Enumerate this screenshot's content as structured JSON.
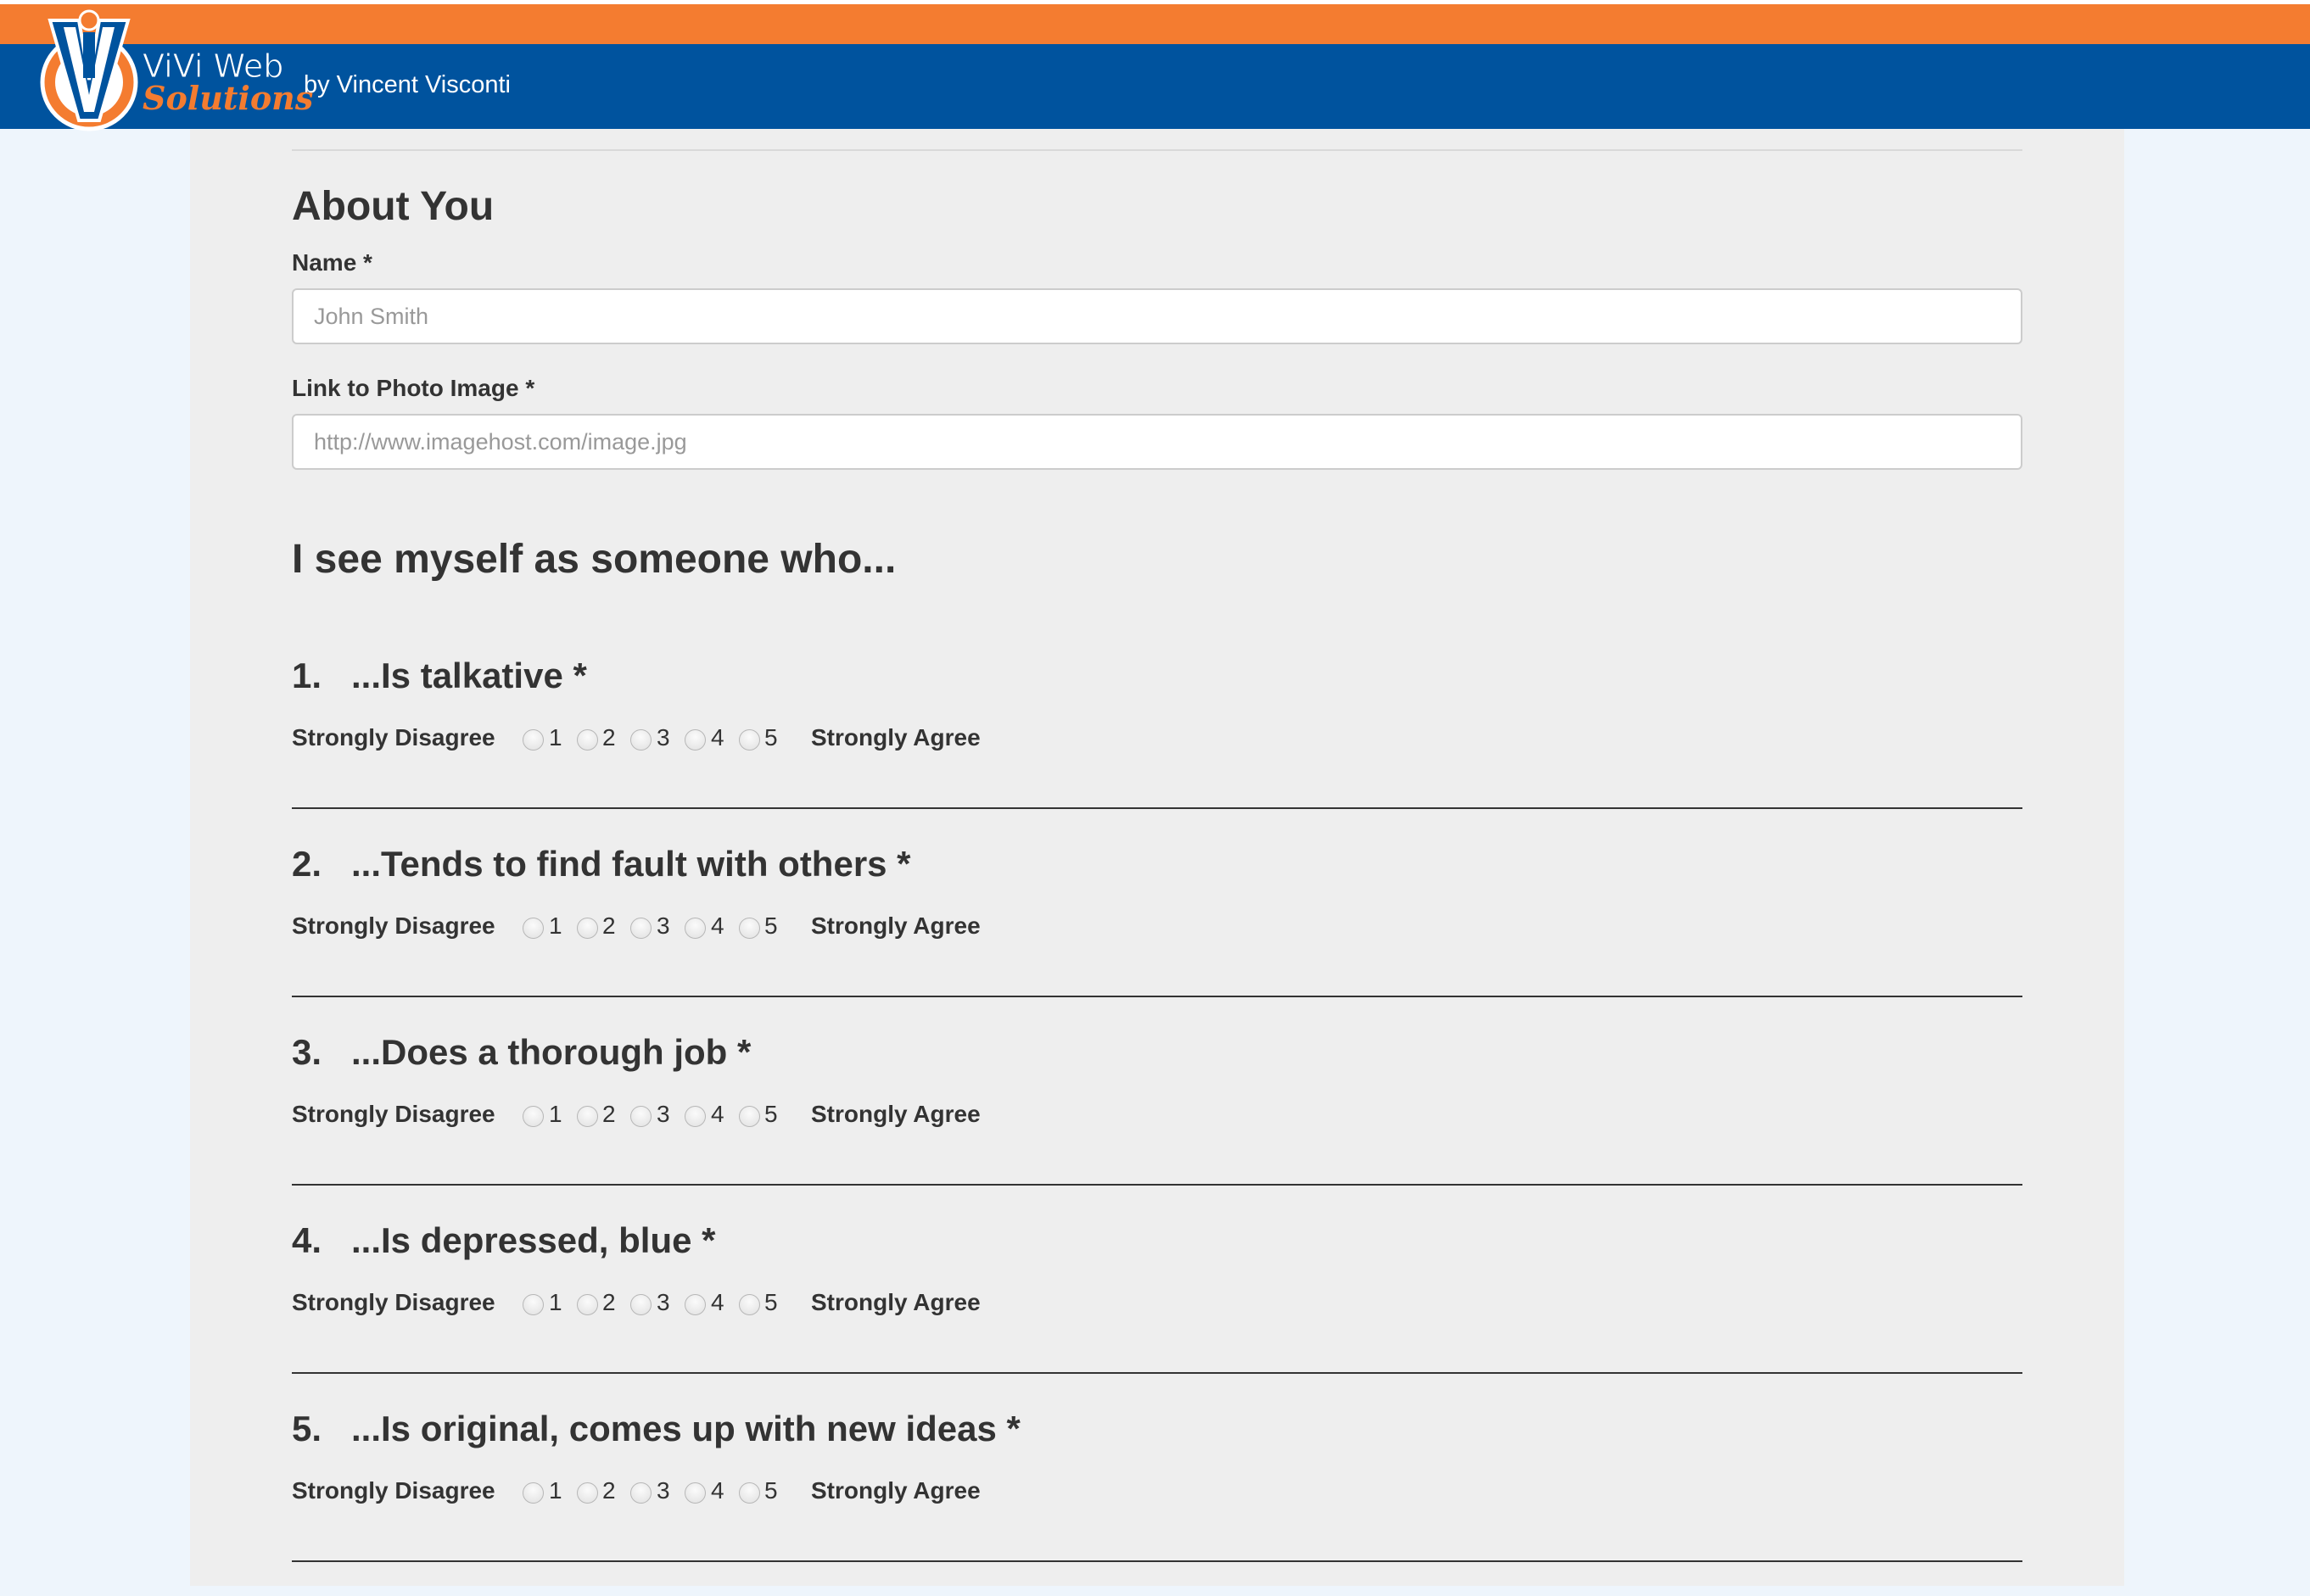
{
  "header": {
    "brand_line1": "ViVi Web",
    "brand_line2": "Solutions",
    "byline": "by Vincent Visconti",
    "colors": {
      "orange": "#f47c30",
      "blue": "#00539e"
    },
    "logo_icon": "vivi-logo-icon"
  },
  "about": {
    "title": "About You",
    "name_label": "Name *",
    "name_placeholder": "John Smith",
    "photo_label": "Link to Photo Image *",
    "photo_placeholder": "http://www.imagehost.com/image.jpg"
  },
  "survey": {
    "heading": "I see myself as someone who...",
    "scale_left": "Strongly Disagree",
    "scale_right": "Strongly Agree",
    "options": [
      "1",
      "2",
      "3",
      "4",
      "5"
    ],
    "questions": [
      {
        "num": "1.",
        "text": "...Is talkative *"
      },
      {
        "num": "2.",
        "text": "...Tends to find fault with others *"
      },
      {
        "num": "3.",
        "text": "...Does a thorough job *"
      },
      {
        "num": "4.",
        "text": "...Is depressed, blue *"
      },
      {
        "num": "5.",
        "text": "...Is original, comes up with new ideas *"
      }
    ]
  }
}
